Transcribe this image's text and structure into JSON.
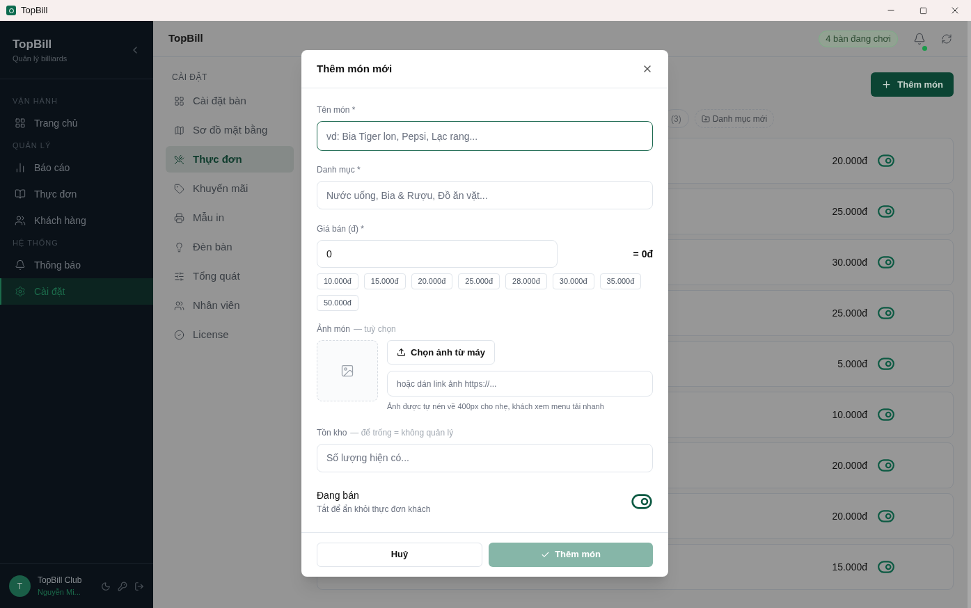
{
  "window": {
    "title": "TopBill"
  },
  "sidebar": {
    "brand": "TopBill",
    "subtitle": "Quản lý billiards",
    "groups": [
      {
        "heading": "VẬN HÀNH",
        "items": [
          {
            "label": "Trang chủ",
            "selected": false
          }
        ]
      },
      {
        "heading": "QUẢN LÝ",
        "items": [
          {
            "label": "Báo cáo",
            "selected": false
          },
          {
            "label": "Thực đơn",
            "selected": false
          },
          {
            "label": "Khách hàng",
            "selected": false
          }
        ]
      },
      {
        "heading": "HỆ THỐNG",
        "items": [
          {
            "label": "Thông báo",
            "selected": false
          },
          {
            "label": "Cài đặt",
            "selected": true
          }
        ]
      }
    ],
    "user": {
      "initial": "T",
      "name": "TopBill Club",
      "person": "Nguyễn Mi..."
    }
  },
  "header": {
    "title": "TopBill",
    "badge": "4 bàn đang chơi",
    "notification_dot": true
  },
  "settings_nav": {
    "heading": "CÀI ĐẶT",
    "items": [
      {
        "label": "Cài đặt bàn",
        "selected": false
      },
      {
        "label": "Sơ đồ mặt bằng",
        "selected": false
      },
      {
        "label": "Thực đơn",
        "selected": true
      },
      {
        "label": "Khuyến mãi",
        "selected": false
      },
      {
        "label": "Mẫu in",
        "selected": false
      },
      {
        "label": "Đèn bàn",
        "selected": false
      },
      {
        "label": "Tổng quát",
        "selected": false
      },
      {
        "label": "Nhân viên",
        "selected": false
      },
      {
        "label": "License",
        "selected": false
      }
    ]
  },
  "menu_page": {
    "add_button": "Thêm món",
    "category_chip": "(3)",
    "new_category": "Danh mục mới",
    "items": [
      {
        "price": "20.000đ",
        "on": true
      },
      {
        "price": "25.000đ",
        "on": true
      },
      {
        "price": "30.000đ",
        "on": true
      },
      {
        "price": "25.000đ",
        "on": true
      },
      {
        "price": "5.000đ",
        "on": true
      },
      {
        "price": "10.000đ",
        "on": true
      },
      {
        "price": "20.000đ",
        "on": true
      },
      {
        "price": "20.000đ",
        "on": true
      },
      {
        "price": "15.000đ",
        "on": true
      }
    ]
  },
  "dialog": {
    "title": "Thêm món mới",
    "name_field": {
      "label": "Tên món *",
      "placeholder": "vd: Bia Tiger lon, Pepsi, Lạc rang..."
    },
    "category_field": {
      "label": "Danh mục *",
      "placeholder": "Nước uống, Bia & Rượu, Đồ ăn vặt..."
    },
    "price_field": {
      "label": "Giá bán (đ) *",
      "value": "0",
      "total": "= 0đ",
      "presets": [
        "10.000đ",
        "15.000đ",
        "20.000đ",
        "25.000đ",
        "28.000đ",
        "30.000đ",
        "35.000đ",
        "50.000đ"
      ]
    },
    "image": {
      "label": "Ảnh món",
      "hint": "— tuỳ chọn",
      "upload_button": "Chọn ảnh từ máy",
      "url_placeholder": "hoặc dán link ảnh https://...",
      "note": "Ảnh được tự nén về 400px cho nhẹ, khách xem menu tải nhanh"
    },
    "stock_field": {
      "label": "Tồn kho",
      "hint": "— để trống = không quản lý",
      "placeholder": "Số lượng hiện có..."
    },
    "on_sale": {
      "label": "Đang bán",
      "description": "Tắt để ẩn khỏi thực đơn khách",
      "on": true
    },
    "cancel": "Huỷ",
    "submit": "Thêm món",
    "submit_disabled": true
  }
}
